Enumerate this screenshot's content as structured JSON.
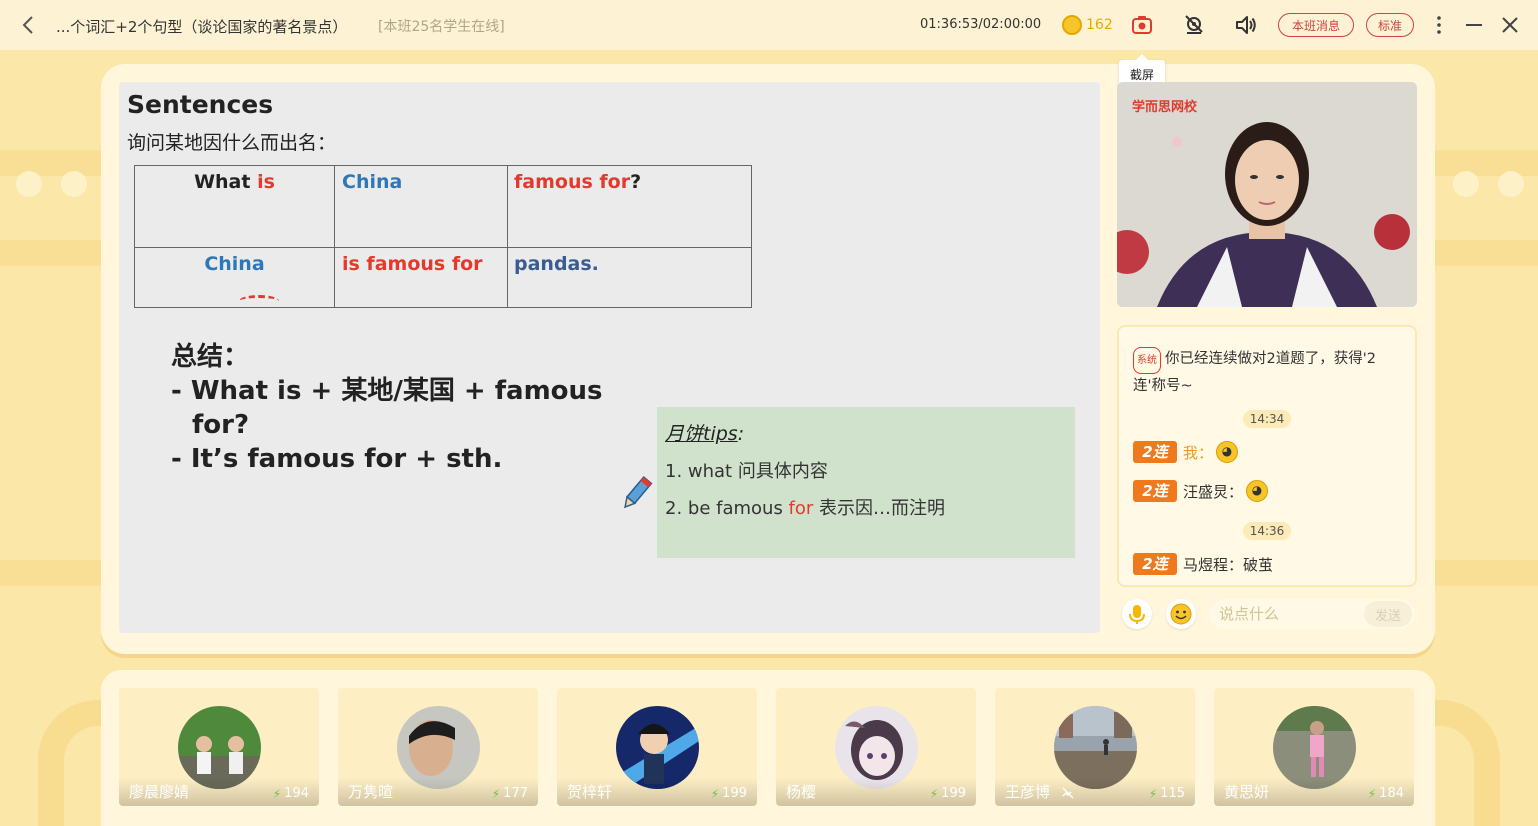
{
  "topbar": {
    "title": "...个词汇+2个句型（谈论国家的著名景点）",
    "online": "[本班25名学生在线]",
    "timer": "01:36:53/02:00:00",
    "coins": "162",
    "class_msg_label": "本班消息",
    "quality_label": "标准",
    "screenshot_tooltip": "截屏"
  },
  "slide": {
    "heading": "Sentences",
    "subheading": "询问某地因什么而出名：",
    "table": {
      "r1c1a": "What ",
      "r1c1b": "is",
      "r1c2": "China",
      "r1c3a": "famous for",
      "r1c3b": "?",
      "r2c1": "China",
      "r2c2": "is famous for",
      "r2c3": "pandas."
    },
    "summary_title": "总结：",
    "summary_line1": "- What is + 某地/某国 + famous",
    "summary_line1b": "for?",
    "summary_line2": "- It’s famous for + sth.",
    "tips_title": "月饼tips",
    "tips_colon": ":",
    "tip1": "1.    what 问具体内容",
    "tip2a": "2.    be  famous ",
    "tip2b": "for",
    "tip2c": " 表示因…而注明"
  },
  "video": {
    "logo": "学而思网校"
  },
  "chat": {
    "system_badge": "系统",
    "system_message": "你已经连续做对2道题了，获得'2连'称号~",
    "time1": "14:34",
    "msg1_name": "我：",
    "msg2_name": "汪盛炅：",
    "time2": "14:36",
    "msg3_name": "马煜程：",
    "msg3_text": "破茧",
    "streak_label": "2连",
    "input_placeholder": "说点什么",
    "send_label": "发送"
  },
  "students": [
    {
      "name": "廖晨廖婧",
      "score": "194"
    },
    {
      "name": "万隽暄",
      "score": "177"
    },
    {
      "name": "贺梓轩",
      "score": "199"
    },
    {
      "name": "杨樱",
      "score": "199"
    },
    {
      "name": "王彦博",
      "score": "115"
    },
    {
      "name": "黄思妍",
      "score": "184"
    }
  ],
  "colors": {
    "accent_red": "#e23a2c",
    "streak_orange": "#f0791d",
    "background": "#fbe7a8"
  }
}
